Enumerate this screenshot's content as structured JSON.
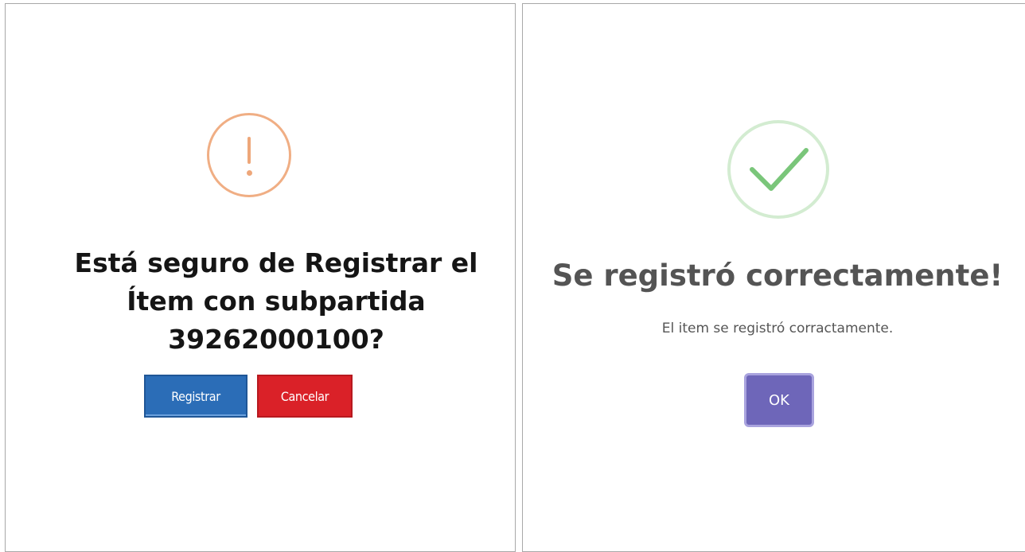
{
  "confirm_dialog": {
    "icon": "exclamation-warning-icon",
    "title_lines": [
      "Está seguro de Registrar el",
      "Ítem con subpartida",
      "39262000100?"
    ],
    "buttons": {
      "register_label": "Registrar",
      "cancel_label": "Cancelar"
    },
    "colors": {
      "icon": "#f0ae84",
      "register": "#2b6db7",
      "cancel": "#da2128"
    }
  },
  "success_dialog": {
    "icon": "checkmark-success-icon",
    "title": "Se registró correctamente!",
    "message": "El item se registró corractamente.",
    "ok_label": "OK",
    "colors": {
      "icon_ring": "#d3ecd1",
      "check": "#7ac67a",
      "ok": "#6e66b9"
    }
  }
}
